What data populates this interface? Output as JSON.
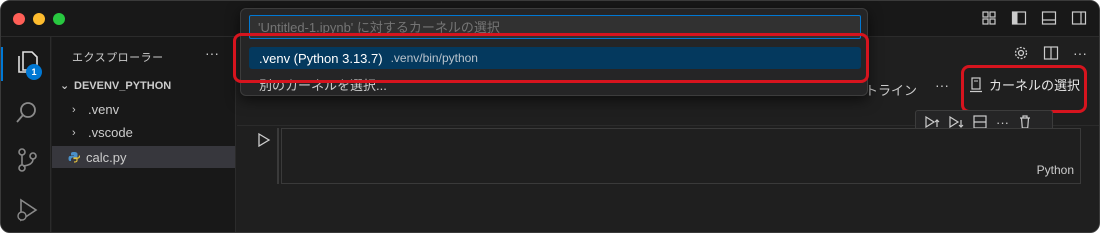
{
  "quick_pick": {
    "placeholder": "'Untitled-1.ipynb' に対するカーネルの選択",
    "items": [
      {
        "label": ".venv (Python 3.13.7)",
        "detail": ".venv/bin/python",
        "selected": true
      },
      {
        "label": "別のカーネルを選択..."
      }
    ]
  },
  "activity_bar": {
    "explorer_badge": "1",
    "icons": [
      "files-icon",
      "search-icon",
      "source-control-icon",
      "run-debug-icon"
    ]
  },
  "sidebar": {
    "title": "エクスプローラー",
    "more": "···",
    "root_folder": "DEVENV_PYTHON",
    "items": [
      {
        "label": ".venv",
        "type": "folder"
      },
      {
        "label": ".vscode",
        "type": "folder"
      },
      {
        "label": "calc.py",
        "type": "file",
        "selected": true
      }
    ]
  },
  "editor": {
    "outline_label": "トライン",
    "more": "···",
    "kernel_button": "カーネルの選択",
    "cell_language": "Python"
  },
  "colors": {
    "accent": "#0078d4",
    "highlight": "#d6141e",
    "background": "#1f1f1f",
    "selected_item": "#04395e"
  }
}
